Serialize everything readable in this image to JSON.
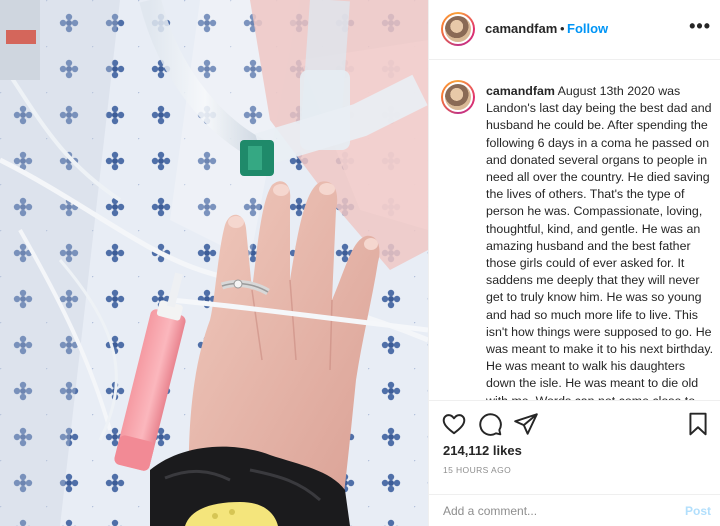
{
  "post": {
    "username": "camandfam",
    "separator": "•",
    "follow_label": "Follow",
    "more_label": "•••"
  },
  "caption": {
    "username": "camandfam",
    "text": " August 13th 2020 was Landon's last day being the best dad and husband he could be. After spending the following 6 days in a coma he passed on and donated several organs to people in need all over the country. He died saving the lives of others. That's the type of person he was. Compassionate, loving, thoughtful, kind, and gentle. He was an amazing husband and the best father those girls could of ever asked for. It saddens me deeply that they will never get to truly know him. He was so young and had so much more life to live. This isn't how things were supposed to go. He was meant to make it to his next birthday. He was meant to walk his daughters down the isle. He was meant to die old with me. Words can not come close to describe the pain I feel. All I can"
  },
  "actions": {
    "icons": [
      "heart-icon",
      "comment-icon",
      "share-icon",
      "bookmark-icon"
    ],
    "likes": "214,112 likes",
    "timestamp": "15 HOURS AGO"
  },
  "comment": {
    "placeholder": "Add a comment...",
    "post_label": "Post"
  },
  "colors": {
    "link_blue": "#0095f6",
    "post_disabled": "#b2dffc",
    "muted": "#8e8e8e"
  }
}
